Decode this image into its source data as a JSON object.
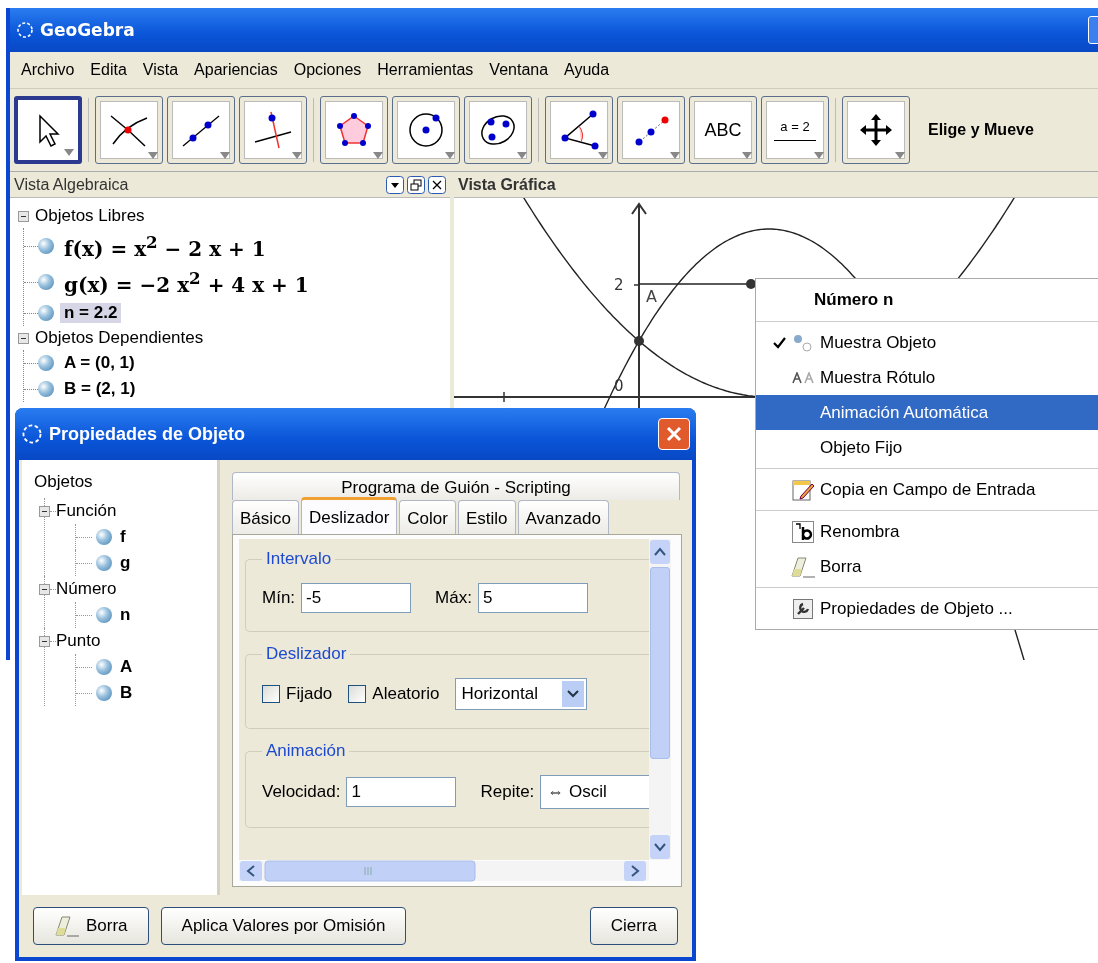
{
  "window": {
    "title": "GeoGebra"
  },
  "menu": [
    "Archivo",
    "Edita",
    "Vista",
    "Apariencias",
    "Opciones",
    "Herramientas",
    "Ventana",
    "Ayuda"
  ],
  "toolbar": {
    "tool_groups": [
      [
        {
          "kind": "move",
          "selected": true
        }
      ],
      [
        {
          "kind": "intersect",
          "selected": false
        },
        {
          "kind": "line",
          "selected": false
        },
        {
          "kind": "perpendicular",
          "selected": false
        }
      ],
      [
        {
          "kind": "polygon",
          "selected": false
        },
        {
          "kind": "circle",
          "selected": false
        },
        {
          "kind": "conic",
          "selected": false
        }
      ],
      [
        {
          "kind": "angle",
          "selected": false
        },
        {
          "kind": "reflect",
          "selected": false
        },
        {
          "kind": "text",
          "text": "ABC",
          "selected": false
        },
        {
          "kind": "slider",
          "text": "a = 2",
          "selected": false
        }
      ],
      [
        {
          "kind": "move-view",
          "selected": false
        }
      ]
    ],
    "tool_name": "Elige y Mueve"
  },
  "algebra_view": {
    "title": "Vista Algebraica",
    "groups": [
      {
        "label": "Objetos Libres",
        "expanded": true,
        "children": [
          {
            "kind": "math",
            "text": "f(x) = x$^{2}$ − 2 x + 1",
            "selected": false
          },
          {
            "kind": "math",
            "text": "g(x) = −2 x$^{2}$ + 4 x + 1",
            "selected": false
          },
          {
            "kind": "plain",
            "text": "n = 2.2",
            "selected": true
          }
        ]
      },
      {
        "label": "Objetos Dependientes",
        "expanded": true,
        "children": [
          {
            "kind": "plain",
            "text": "A = (0, 1)",
            "selected": false
          },
          {
            "kind": "plain",
            "text": "B = (2, 1)",
            "selected": false
          }
        ]
      }
    ]
  },
  "graphics_view": {
    "title": "Vista Gráfica",
    "y_tick": "2",
    "origin_label": "0",
    "point_label": "A"
  },
  "context_menu": {
    "title": "Número n",
    "sections": [
      [
        {
          "kind": "check",
          "label": "Muestra Objeto",
          "checked": true,
          "selected": false
        },
        {
          "kind": "check",
          "label": "Muestra Rótulo",
          "checked": false,
          "selected": false
        },
        {
          "kind": "check",
          "label": "Animación Automática",
          "checked": false,
          "selected": true
        },
        {
          "kind": "check",
          "label": "Objeto Fijo",
          "checked": false,
          "selected": false
        }
      ],
      [
        {
          "kind": "action",
          "label": "Copia en Campo de Entrada",
          "selected": false
        }
      ],
      [
        {
          "kind": "action",
          "label": "Renombra",
          "selected": false
        },
        {
          "kind": "action",
          "label": "Borra",
          "selected": false
        }
      ],
      [
        {
          "kind": "action",
          "label": "Propiedades de Objeto ...",
          "selected": false
        }
      ]
    ]
  },
  "dialog": {
    "title": "Propiedades de Objeto",
    "tree": {
      "label": "Objetos",
      "children": [
        {
          "label": "Función",
          "expanded": true,
          "children": [
            "f",
            "g"
          ]
        },
        {
          "label": "Número",
          "expanded": true,
          "children": [
            "n"
          ]
        },
        {
          "label": "Punto",
          "expanded": true,
          "children": [
            "A",
            "B"
          ]
        }
      ]
    },
    "tab_rows": [
      [
        {
          "label": "Programa de Guión - Scripting",
          "selected": false
        }
      ],
      [
        {
          "label": "Básico",
          "selected": false
        },
        {
          "label": "Deslizador",
          "selected": true
        },
        {
          "label": "Color",
          "selected": false
        },
        {
          "label": "Estilo",
          "selected": false
        },
        {
          "label": "Avanzado",
          "selected": false
        }
      ]
    ],
    "interval": {
      "title": "Intervalo",
      "min_label": "Mín:",
      "min": "-5",
      "max_label": "Máx:",
      "max": "5"
    },
    "slider": {
      "title": "Deslizador",
      "fixed": {
        "label": "Fijado",
        "checked": false
      },
      "random": {
        "label": "Aleatorio",
        "checked": false
      },
      "orientation": "Horizontal"
    },
    "animation": {
      "title": "Animación",
      "speed_label": "Velocidad:",
      "speed": "1",
      "repeat_label": "Repite:",
      "repeat": "⇔ Oscil"
    },
    "buttons": [
      {
        "kind": "delete",
        "label": "Borra"
      },
      {
        "kind": "defaults",
        "label": "Aplica Valores por Omisión"
      },
      {
        "kind": "close",
        "label": "Cierra"
      }
    ]
  }
}
